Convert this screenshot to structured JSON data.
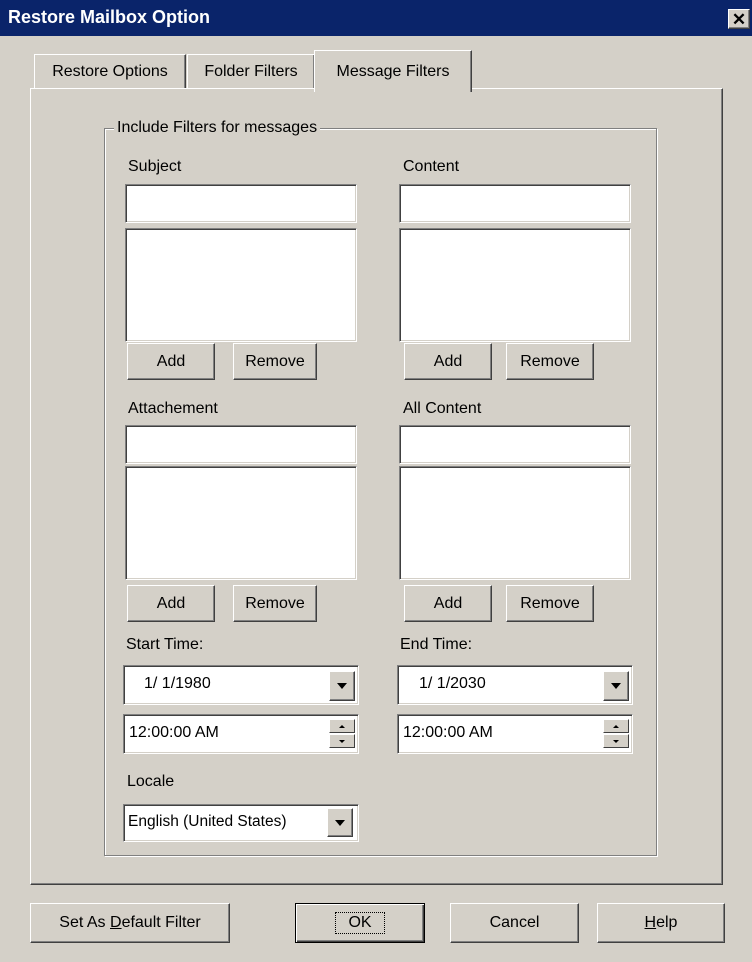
{
  "window": {
    "title": "Restore Mailbox Option",
    "close_label": "✕"
  },
  "tabs": [
    {
      "label": "Restore Options"
    },
    {
      "label": "Folder Filters"
    },
    {
      "label": "Message Filters"
    }
  ],
  "active_tab": "Message Filters",
  "group": {
    "label": "Include Filters for messages"
  },
  "filters": {
    "subject": {
      "label": "Subject",
      "value": "",
      "items": [],
      "add": "Add",
      "remove": "Remove"
    },
    "content": {
      "label": "Content",
      "value": "",
      "items": [],
      "add": "Add",
      "remove": "Remove"
    },
    "attachment": {
      "label": "Attachement",
      "value": "",
      "items": [],
      "add": "Add",
      "remove": "Remove"
    },
    "all_content": {
      "label": "All Content",
      "value": "",
      "items": [],
      "add": "Add",
      "remove": "Remove"
    }
  },
  "start_time": {
    "label": "Start Time:",
    "date": "1/ 1/1980",
    "time": "12:00:00 AM"
  },
  "end_time": {
    "label": "End Time:",
    "date": "1/ 1/2030",
    "time": "12:00:00 AM"
  },
  "locale": {
    "label": "Locale",
    "value": "English (United States)"
  },
  "footer": {
    "set_default_pre": "Set As ",
    "set_default_key": "D",
    "set_default_post": "efault Filter",
    "ok": "OK",
    "cancel": "Cancel",
    "help_key": "H",
    "help_post": "elp"
  }
}
